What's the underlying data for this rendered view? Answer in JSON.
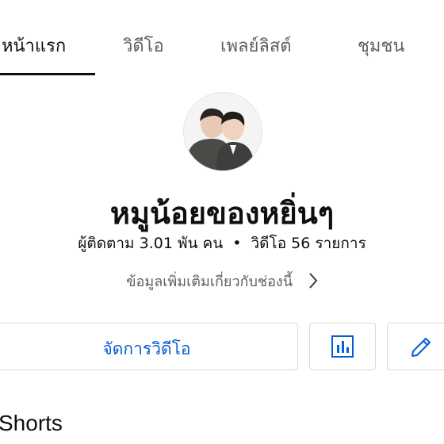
{
  "tabs": [
    {
      "label": "หน้าแรก",
      "active": true
    },
    {
      "label": "วิดีโอ",
      "active": false
    },
    {
      "label": "เพลย์ลิสต์",
      "active": false
    },
    {
      "label": "ชุมชน",
      "active": false
    }
  ],
  "channel": {
    "name": "หมูน้อยของหยิ่นๆ",
    "subscribers": "ผู้ติดตาม 3.01 พัน คน",
    "separator": "•",
    "videos": "วิดีโอ 56 รายการ",
    "more_info": "ข้อมูลเพิ่มเติมเกี่ยวกับช่องนี้"
  },
  "actions": {
    "manage_videos": "จัดการวิดีโอ",
    "analytics_icon": "bar-chart-icon",
    "edit_icon": "pencil-icon"
  },
  "sections": {
    "shorts_title": "Shorts"
  },
  "colors": {
    "accent": "#065fd4",
    "text_primary": "#0f0f0f",
    "text_secondary": "#606060",
    "border": "#d9d9d9"
  }
}
